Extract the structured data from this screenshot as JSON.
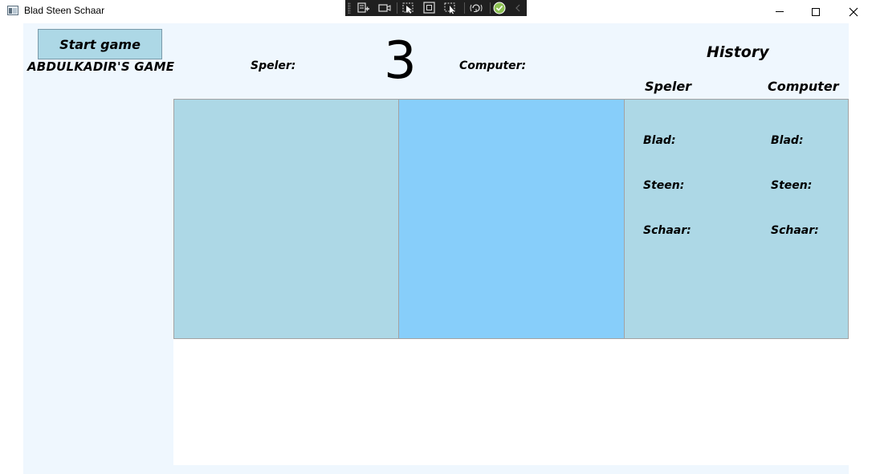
{
  "window": {
    "title": "Blad Steen Schaar",
    "controls": [
      "minimize-icon",
      "maximize-icon",
      "close-icon"
    ]
  },
  "debug_toolbar": {
    "icons": [
      "live-visual-tree-icon",
      "select-element-icon",
      "show-layout-adorners-icon",
      "track-focus-icon",
      "display-layout-icon",
      "hot-reload-icon",
      "binding-failures-check-icon",
      "collapse-toolbar-icon"
    ]
  },
  "game": {
    "start_button_label": "Start game",
    "title": "ABDULKADIR'S GAME",
    "player_label": "Speler:",
    "computer_label": "Computer:",
    "countdown": "3"
  },
  "history": {
    "title": "History",
    "player_header": "Speler",
    "computer_header": "Computer",
    "player_rows": [
      "Blad:",
      "Steen:",
      "Schaar:"
    ],
    "computer_rows": [
      "Blad:",
      "Steen:",
      "Schaar:"
    ]
  },
  "colors": {
    "client_background": "#eff7fe",
    "player_panel": "#add8e6",
    "computer_panel": "#87cefa",
    "history_panel": "#add8e6",
    "start_button": "#add8e6"
  }
}
